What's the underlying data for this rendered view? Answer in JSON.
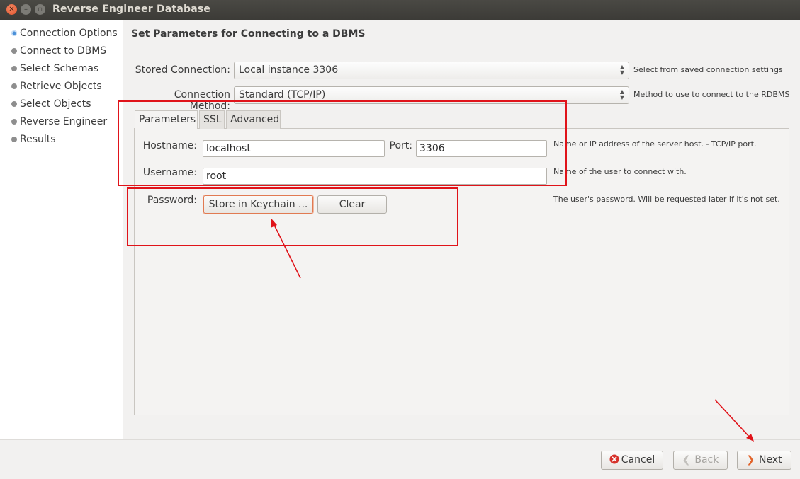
{
  "window": {
    "title": "Reverse Engineer Database"
  },
  "sidebar": {
    "steps": [
      {
        "label": "Connection Options",
        "active": true
      },
      {
        "label": "Connect to DBMS",
        "active": false
      },
      {
        "label": "Select Schemas",
        "active": false
      },
      {
        "label": "Retrieve Objects",
        "active": false
      },
      {
        "label": "Select Objects",
        "active": false
      },
      {
        "label": "Reverse Engineer",
        "active": false
      },
      {
        "label": "Results",
        "active": false
      }
    ]
  },
  "main": {
    "title": "Set Parameters for Connecting to a DBMS",
    "stored_connection": {
      "label": "Stored Connection:",
      "value": "Local instance 3306",
      "hint": "Select from saved connection settings"
    },
    "connection_method": {
      "label": "Connection Method:",
      "value": "Standard (TCP/IP)",
      "hint": "Method to use to connect to the RDBMS"
    },
    "tabs": [
      {
        "label": "Parameters",
        "active": true
      },
      {
        "label": "SSL",
        "active": false
      },
      {
        "label": "Advanced",
        "active": false
      }
    ],
    "parameters": {
      "hostname": {
        "label": "Hostname:",
        "value": "localhost"
      },
      "port": {
        "label": "Port:",
        "value": "3306"
      },
      "host_hint": "Name or IP address of the server host. - TCP/IP port.",
      "username": {
        "label": "Username:",
        "value": "root",
        "hint": "Name of the user to connect with."
      },
      "password": {
        "label": "Password:",
        "store_button": "Store in Keychain ...",
        "clear_button": "Clear",
        "hint": "The user's password. Will be requested later if it's not set."
      }
    }
  },
  "footer": {
    "cancel": "Cancel",
    "back": "Back",
    "next": "Next"
  },
  "colors": {
    "annotation_red": "#e0131a",
    "active_step": "#4a90d9"
  }
}
